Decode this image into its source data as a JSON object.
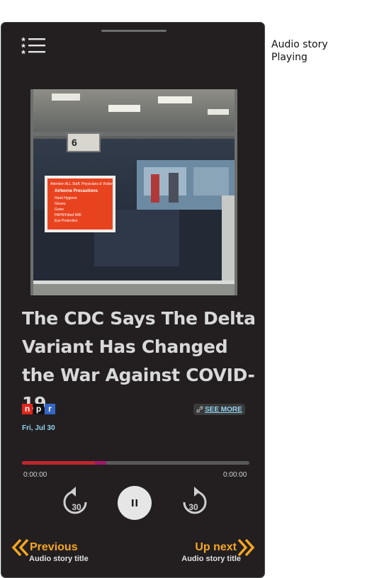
{
  "status": {
    "line1": "Audio story",
    "line2": "Playing"
  },
  "story": {
    "title": "The CDC Says The Delta Variant Has Changed the War Against COVID-19",
    "source_letters": [
      "n",
      "p",
      "r"
    ],
    "source_colors": [
      "#e1251b",
      "#111111",
      "#3467c8"
    ],
    "see_more": "SEE MORE",
    "date": "Fri, Jul 30"
  },
  "player": {
    "progress_fraction": 0.32,
    "buffered_fraction": 0.37,
    "elapsed": "0:00:00",
    "duration": "0:00:00",
    "rewind_seconds": "30",
    "forward_seconds": "30"
  },
  "navigation": {
    "previous_label": "Previous",
    "previous_sub": "Audio story title",
    "next_label": "Up next",
    "next_sub": "Audio story title"
  },
  "colors": {
    "accent": "#f5a623",
    "link": "#8fd3ee",
    "progress": "#c0262d",
    "background": "#231f20"
  },
  "icons": [
    "menu-icon",
    "link-icon",
    "rewind-30-icon",
    "pause-icon",
    "forward-30-icon",
    "chevron-left-icon",
    "chevron-right-icon"
  ],
  "image": {
    "sign_number": "6",
    "sign_heading": "Attention ALL Staff, Physicians & Visitors",
    "sign_subheading": "Airborne Precautions",
    "sign_items": [
      "Hand Hygiene",
      "Gloves",
      "Gown",
      "PAPR/Fitted N95",
      "Eye Protection"
    ]
  }
}
